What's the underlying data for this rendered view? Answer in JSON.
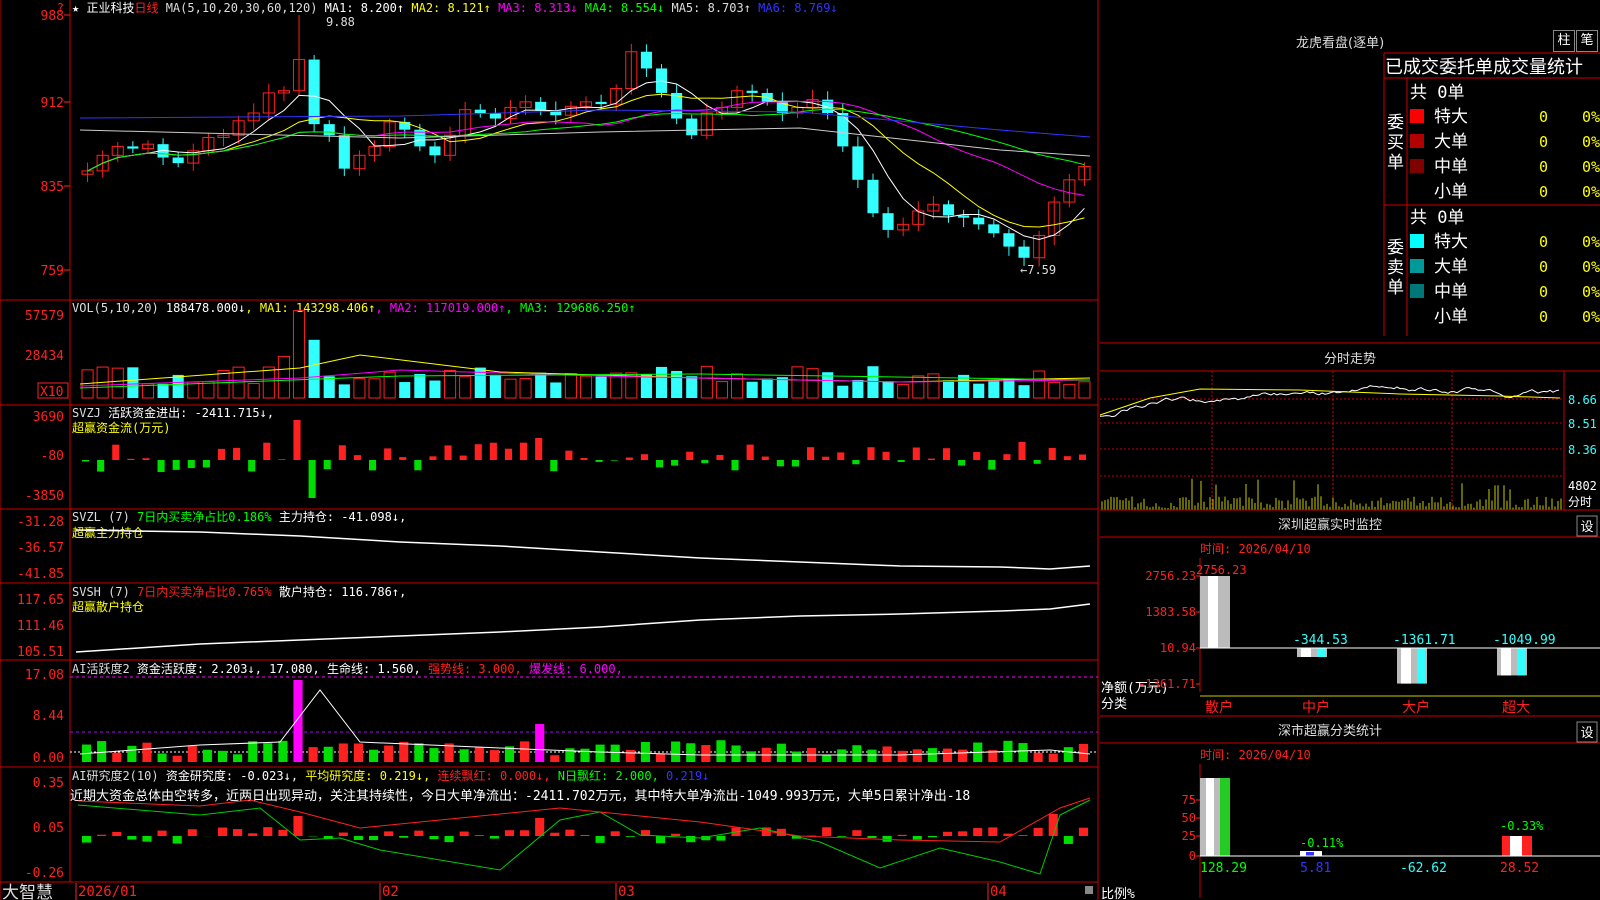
{
  "brand": "大智慧",
  "app": {
    "stock_name": "正业科技",
    "period": "日线",
    "ma_label": "MA(5,10,20,30,60,120)",
    "ma_values": [
      {
        "name": "MA1",
        "value": "8.200",
        "dir": "↑",
        "color": "#ffffff"
      },
      {
        "name": "MA2",
        "value": "8.121",
        "dir": "↑",
        "color": "#ffff00"
      },
      {
        "name": "MA3",
        "value": "8.313",
        "dir": "↓",
        "color": "#ff00ff"
      },
      {
        "name": "MA4",
        "value": "8.554",
        "dir": "↓",
        "color": "#00ff00"
      },
      {
        "name": "MA5",
        "value": "8.703",
        "dir": "↑",
        "color": "#dddddd"
      },
      {
        "name": "MA6",
        "value": "8.769",
        "dir": "↓",
        "color": "#3333ff"
      }
    ],
    "price_high_label": "9.88",
    "price_low_label": "7.59",
    "price_axis": [
      "988",
      "912",
      "835",
      "759"
    ],
    "price_axis_top_mark": "?"
  },
  "volume": {
    "label": "VOL(5,10,20)",
    "value": "188478.000",
    "dir": "↓",
    "ma": [
      {
        "name": "MA1",
        "value": "143298.406",
        "dir": "↑",
        "color": "#ffff00"
      },
      {
        "name": "MA2",
        "value": "117019.000",
        "dir": "↑",
        "color": "#ff00ff"
      },
      {
        "name": "MA3",
        "value": "129686.250",
        "dir": "↑",
        "color": "#00ff00"
      }
    ],
    "axis": [
      "57579",
      "28434"
    ],
    "unit": "X10"
  },
  "svzj": {
    "label": "SVZJ",
    "name": "活跃资金进出:",
    "value": "-2411.715",
    "dir": "↓",
    "sub": "超赢资金流(万元)",
    "axis": [
      "3690",
      "-80",
      "-3850"
    ]
  },
  "svzl": {
    "label": "SVZL (7)",
    "ratio_label": "7日内买卖净占比0.186%",
    "name": "主力持仓:",
    "value": "-41.098",
    "dir": "↓",
    "sub": "超赢主力持仓",
    "axis": [
      "-31.28",
      "-36.57",
      "-41.85"
    ]
  },
  "svsh": {
    "label": "SVSH (7)",
    "ratio_label": "7日内买卖净占比0.765%",
    "name": "散户持仓:",
    "value": "116.786",
    "dir": "↑",
    "sub": "超赢散户持仓",
    "axis": [
      "117.65",
      "111.46",
      "105.51"
    ]
  },
  "ai_active": {
    "label": "AI活跃度2",
    "name": "资金活跃度:",
    "value": "2.203",
    "dir": "↓",
    "v2": "17.080",
    "life_name": "生命线:",
    "life_value": "1.560",
    "strong": "强势线: 3.000",
    "burst": "爆发线: 6.000",
    "axis": [
      "17.08",
      "8.44",
      "0.00"
    ]
  },
  "ai_research": {
    "label": "AI研究度2(10)",
    "name": "资金研究度:",
    "value": "-0.023",
    "dir": "↓",
    "avg": "平均研究度: 0.219",
    "avg_dir": "↓",
    "red": "连续飘红: 0.000",
    "red_dir": "↓",
    "nred": "N日飘红: 2.000",
    "extra": "0.219",
    "extra_dir": "↓",
    "comment": "近期大资金总体由空转多，近两日出现异动，关注其持续性，今日大单净流出：-2411.702万元，其中特大单净流出-1049.993万元，大单5日累计净出-18",
    "axis": [
      "0.35",
      "0.05",
      "-0.26"
    ]
  },
  "date_axis": [
    "2026/01",
    "02",
    "03",
    "04"
  ],
  "right": {
    "lhb_title": "龙虎看盘(逐单)",
    "btn_zhu": "柱",
    "btn_bi": "笔",
    "stats_title": "已成交委托单成交量统计",
    "buy": {
      "label": "委买单",
      "total": "共 0单",
      "rows": [
        {
          "name": "特大",
          "count": "0",
          "pct": "0%",
          "color": "#ff0000"
        },
        {
          "name": "大单",
          "count": "0",
          "pct": "0%",
          "color": "#b00000"
        },
        {
          "name": "中单",
          "count": "0",
          "pct": "0%",
          "color": "#800000"
        },
        {
          "name": "小单",
          "count": "0",
          "pct": "0%",
          "color": "#000000"
        }
      ]
    },
    "sell": {
      "label": "委卖单",
      "total": "共 0单",
      "rows": [
        {
          "name": "特大",
          "count": "0",
          "pct": "0%",
          "color": "#00ffff"
        },
        {
          "name": "大单",
          "count": "0",
          "pct": "0%",
          "color": "#009999"
        },
        {
          "name": "中单",
          "count": "0",
          "pct": "0%",
          "color": "#007777"
        },
        {
          "name": "小单",
          "count": "0",
          "pct": "0%",
          "color": "#000000"
        }
      ]
    },
    "intraday_title": "分时走势",
    "intraday_axis": [
      "8.66",
      "8.51",
      "8.36"
    ],
    "intraday_vol": "4802",
    "intraday_vol_unit": "分时",
    "monitor": {
      "title": "深圳超赢实时监控",
      "btn": "设",
      "time_label": "时间: 2026/04/10",
      "axis": [
        "2756.23",
        "1383.58",
        "10.94",
        "-1361.71"
      ],
      "ylabel": "净额(万元)",
      "xlabel": "分类",
      "bars": [
        {
          "cat": "散户",
          "value": 2756.23,
          "label": "2756.23"
        },
        {
          "cat": "中户",
          "value": -344.53,
          "label": "-344.53"
        },
        {
          "cat": "大户",
          "value": -1361.71,
          "label": "-1361.71"
        },
        {
          "cat": "超大",
          "value": -1049.99,
          "label": "-1049.99"
        }
      ]
    },
    "classify": {
      "title": "深市超赢分类统计",
      "btn": "设",
      "time_label": "时间: 2026/04/10",
      "axis": [
        "75",
        "50",
        "25",
        "0"
      ],
      "ylabel": "比例%",
      "xlabel": "分类",
      "bars": [
        {
          "cat": "散户",
          "value": 128.29,
          "label": "128.29"
        },
        {
          "cat": "中户",
          "value": -0.11,
          "label": "-0.11%",
          "bottom": "5.81"
        },
        {
          "cat": "大户",
          "value": 0,
          "label": "",
          "bottom": "-62.62"
        },
        {
          "cat": "超大",
          "value": 28.52,
          "label": "-0.33%",
          "bottom": "28.52"
        }
      ]
    }
  }
}
